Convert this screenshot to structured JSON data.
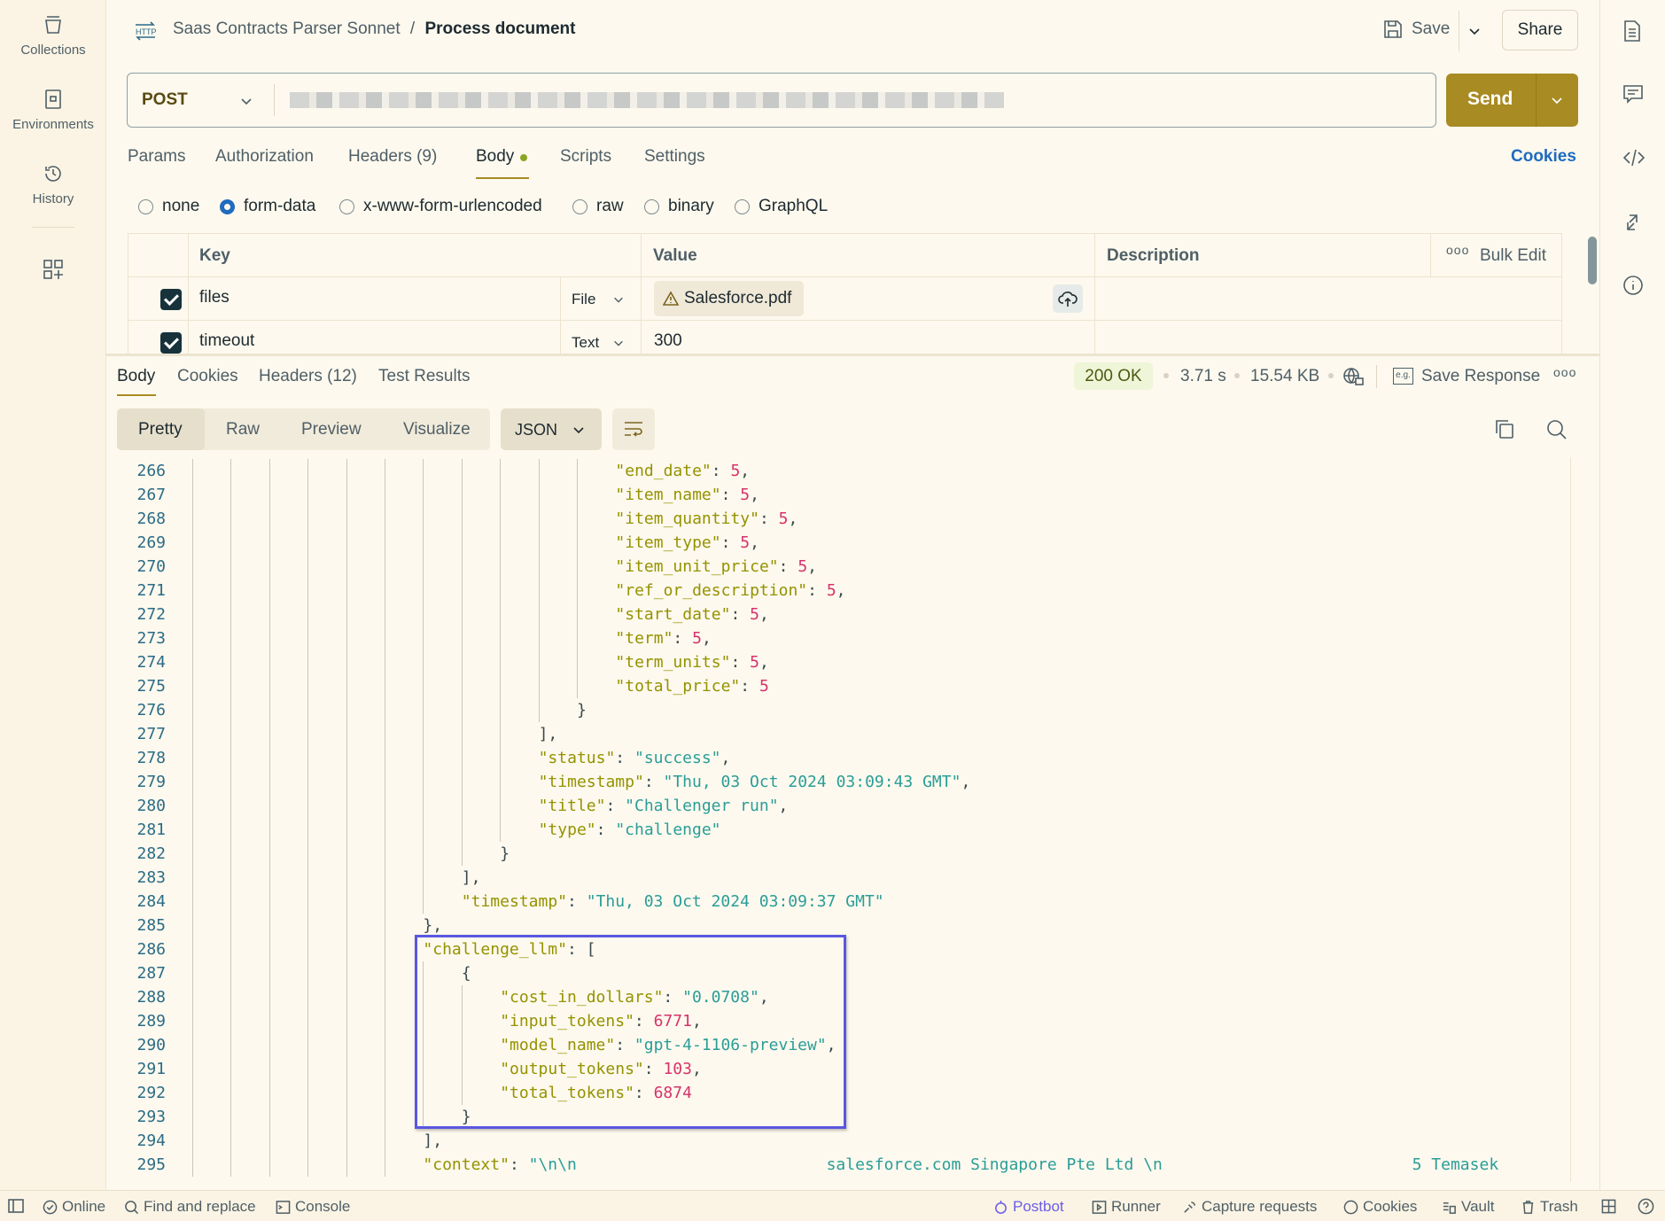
{
  "sidebar": {
    "items": [
      {
        "label": "Collections",
        "icon": "collections-icon"
      },
      {
        "label": "Environments",
        "icon": "environments-icon"
      },
      {
        "label": "History",
        "icon": "history-icon"
      }
    ]
  },
  "header": {
    "collection": "Saas Contracts Parser Sonnet",
    "separator": "/",
    "request": "Process document",
    "save": "Save",
    "share": "Share"
  },
  "request": {
    "method": "POST",
    "url": "",
    "send": "Send"
  },
  "tabs": [
    {
      "label": "Params"
    },
    {
      "label": "Authorization"
    },
    {
      "label": "Headers (9)"
    },
    {
      "label": "Body",
      "active": true
    },
    {
      "label": "Scripts"
    },
    {
      "label": "Settings"
    }
  ],
  "cookies_link": "Cookies",
  "body_types": [
    {
      "label": "none"
    },
    {
      "label": "form-data",
      "selected": true
    },
    {
      "label": "x-www-form-urlencoded"
    },
    {
      "label": "raw"
    },
    {
      "label": "binary"
    },
    {
      "label": "GraphQL"
    }
  ],
  "form_table": {
    "headers": {
      "key": "Key",
      "value": "Value",
      "description": "Description",
      "bulk_edit": "Bulk Edit"
    },
    "rows": [
      {
        "checked": true,
        "key": "files",
        "type": "File",
        "value": "Salesforce.pdf"
      },
      {
        "checked": true,
        "key": "timeout",
        "type": "Text",
        "value": "300"
      }
    ]
  },
  "response": {
    "tabs": [
      {
        "label": "Body",
        "active": true
      },
      {
        "label": "Cookies"
      },
      {
        "label": "Headers (12)"
      },
      {
        "label": "Test Results"
      }
    ],
    "status": "200 OK",
    "time": "3.71 s",
    "size": "15.54 KB",
    "save_response": "Save Response",
    "views": [
      {
        "label": "Pretty",
        "active": true
      },
      {
        "label": "Raw"
      },
      {
        "label": "Preview"
      },
      {
        "label": "Visualize"
      }
    ],
    "format": "JSON",
    "highlight_color": "#5b57e0"
  },
  "code_lines": [
    {
      "n": 266,
      "i": 11,
      "t": [
        [
          "k",
          "\"end_date\""
        ],
        [
          "p",
          ": "
        ],
        [
          "n",
          "5"
        ],
        [
          "p",
          ","
        ]
      ]
    },
    {
      "n": 267,
      "i": 11,
      "t": [
        [
          "k",
          "\"item_name\""
        ],
        [
          "p",
          ": "
        ],
        [
          "n",
          "5"
        ],
        [
          "p",
          ","
        ]
      ]
    },
    {
      "n": 268,
      "i": 11,
      "t": [
        [
          "k",
          "\"item_quantity\""
        ],
        [
          "p",
          ": "
        ],
        [
          "n",
          "5"
        ],
        [
          "p",
          ","
        ]
      ]
    },
    {
      "n": 269,
      "i": 11,
      "t": [
        [
          "k",
          "\"item_type\""
        ],
        [
          "p",
          ": "
        ],
        [
          "n",
          "5"
        ],
        [
          "p",
          ","
        ]
      ]
    },
    {
      "n": 270,
      "i": 11,
      "t": [
        [
          "k",
          "\"item_unit_price\""
        ],
        [
          "p",
          ": "
        ],
        [
          "n",
          "5"
        ],
        [
          "p",
          ","
        ]
      ]
    },
    {
      "n": 271,
      "i": 11,
      "t": [
        [
          "k",
          "\"ref_or_description\""
        ],
        [
          "p",
          ": "
        ],
        [
          "n",
          "5"
        ],
        [
          "p",
          ","
        ]
      ]
    },
    {
      "n": 272,
      "i": 11,
      "t": [
        [
          "k",
          "\"start_date\""
        ],
        [
          "p",
          ": "
        ],
        [
          "n",
          "5"
        ],
        [
          "p",
          ","
        ]
      ]
    },
    {
      "n": 273,
      "i": 11,
      "t": [
        [
          "k",
          "\"term\""
        ],
        [
          "p",
          ": "
        ],
        [
          "n",
          "5"
        ],
        [
          "p",
          ","
        ]
      ]
    },
    {
      "n": 274,
      "i": 11,
      "t": [
        [
          "k",
          "\"term_units\""
        ],
        [
          "p",
          ": "
        ],
        [
          "n",
          "5"
        ],
        [
          "p",
          ","
        ]
      ]
    },
    {
      "n": 275,
      "i": 11,
      "t": [
        [
          "k",
          "\"total_price\""
        ],
        [
          "p",
          ": "
        ],
        [
          "n",
          "5"
        ]
      ]
    },
    {
      "n": 276,
      "i": 10,
      "t": [
        [
          "p",
          "}"
        ]
      ]
    },
    {
      "n": 277,
      "i": 9,
      "t": [
        [
          "p",
          "],"
        ]
      ]
    },
    {
      "n": 278,
      "i": 9,
      "t": [
        [
          "k",
          "\"status\""
        ],
        [
          "p",
          ": "
        ],
        [
          "s",
          "\"success\""
        ],
        [
          "p",
          ","
        ]
      ]
    },
    {
      "n": 279,
      "i": 9,
      "t": [
        [
          "k",
          "\"timestamp\""
        ],
        [
          "p",
          ": "
        ],
        [
          "s",
          "\"Thu, 03 Oct 2024 03:09:43 GMT\""
        ],
        [
          "p",
          ","
        ]
      ]
    },
    {
      "n": 280,
      "i": 9,
      "t": [
        [
          "k",
          "\"title\""
        ],
        [
          "p",
          ": "
        ],
        [
          "s",
          "\"Challenger run\""
        ],
        [
          "p",
          ","
        ]
      ]
    },
    {
      "n": 281,
      "i": 9,
      "t": [
        [
          "k",
          "\"type\""
        ],
        [
          "p",
          ": "
        ],
        [
          "s",
          "\"challenge\""
        ]
      ]
    },
    {
      "n": 282,
      "i": 8,
      "t": [
        [
          "p",
          "}"
        ]
      ]
    },
    {
      "n": 283,
      "i": 7,
      "t": [
        [
          "p",
          "],"
        ]
      ]
    },
    {
      "n": 284,
      "i": 7,
      "t": [
        [
          "k",
          "\"timestamp\""
        ],
        [
          "p",
          ": "
        ],
        [
          "s",
          "\"Thu, 03 Oct 2024 03:09:37 GMT\""
        ]
      ]
    },
    {
      "n": 285,
      "i": 6,
      "t": [
        [
          "p",
          "},"
        ]
      ]
    },
    {
      "n": 286,
      "i": 6,
      "t": [
        [
          "k",
          "\"challenge_llm\""
        ],
        [
          "p",
          ": ["
        ]
      ]
    },
    {
      "n": 287,
      "i": 7,
      "t": [
        [
          "p",
          "{"
        ]
      ]
    },
    {
      "n": 288,
      "i": 8,
      "t": [
        [
          "k",
          "\"cost_in_dollars\""
        ],
        [
          "p",
          ": "
        ],
        [
          "s",
          "\"0.0708\""
        ],
        [
          "p",
          ","
        ]
      ]
    },
    {
      "n": 289,
      "i": 8,
      "t": [
        [
          "k",
          "\"input_tokens\""
        ],
        [
          "p",
          ": "
        ],
        [
          "n",
          "6771"
        ],
        [
          "p",
          ","
        ]
      ]
    },
    {
      "n": 290,
      "i": 8,
      "t": [
        [
          "k",
          "\"model_name\""
        ],
        [
          "p",
          ": "
        ],
        [
          "s",
          "\"gpt-4-1106-preview\""
        ],
        [
          "p",
          ","
        ]
      ]
    },
    {
      "n": 291,
      "i": 8,
      "t": [
        [
          "k",
          "\"output_tokens\""
        ],
        [
          "p",
          ": "
        ],
        [
          "n",
          "103"
        ],
        [
          "p",
          ","
        ]
      ]
    },
    {
      "n": 292,
      "i": 8,
      "t": [
        [
          "k",
          "\"total_tokens\""
        ],
        [
          "p",
          ": "
        ],
        [
          "n",
          "6874"
        ]
      ]
    },
    {
      "n": 293,
      "i": 7,
      "t": [
        [
          "p",
          "}"
        ]
      ]
    },
    {
      "n": 294,
      "i": 6,
      "t": [
        [
          "p",
          "],"
        ]
      ]
    },
    {
      "n": 295,
      "i": 6,
      "t": [
        [
          "k",
          "\"context\""
        ],
        [
          "p",
          ": "
        ],
        [
          "s",
          "\"\\n\\n                          salesforce.com Singapore Pte Ltd \\n                          5 Temasek"
        ]
      ]
    }
  ],
  "statusbar": {
    "left": [
      {
        "label": "Online",
        "icon": "check-circle-icon"
      },
      {
        "label": "Find and replace",
        "icon": "search-icon"
      },
      {
        "label": "Console",
        "icon": "console-icon"
      }
    ],
    "right": [
      {
        "label": "Postbot",
        "icon": "postbot-icon",
        "color": "#6b5ce7"
      },
      {
        "label": "Runner",
        "icon": "runner-icon"
      },
      {
        "label": "Capture requests",
        "icon": "capture-icon"
      },
      {
        "label": "Cookies",
        "icon": "cookie-icon"
      },
      {
        "label": "Vault",
        "icon": "vault-icon"
      },
      {
        "label": "Trash",
        "icon": "trash-icon"
      }
    ]
  },
  "colors": {
    "send": "#a88b22",
    "accent_link": "#1f6bbf",
    "status_ok_bg": "#eef5d8",
    "background": "#fdf9ee"
  }
}
